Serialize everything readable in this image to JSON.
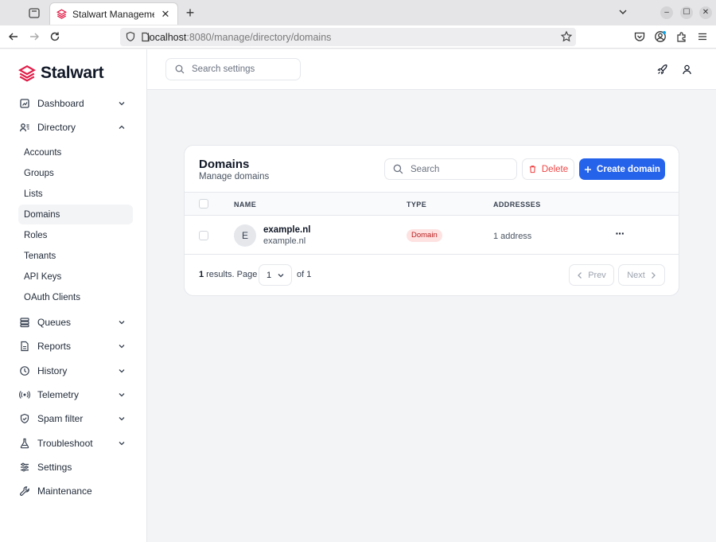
{
  "browser": {
    "tab_title": "Stalwart Management",
    "url_host": "localhost",
    "url_rest": ":8080/manage/directory/domains"
  },
  "brand": {
    "name": "Stalwart",
    "color": "#e11d48"
  },
  "search_settings": {
    "placeholder": "Search settings"
  },
  "sidebar": {
    "items": [
      {
        "label": "Dashboard",
        "icon": "dashboard-icon",
        "expanded": false
      },
      {
        "label": "Directory",
        "icon": "directory-icon",
        "expanded": true
      },
      {
        "label": "Queues",
        "icon": "queues-icon",
        "expanded": false
      },
      {
        "label": "Reports",
        "icon": "reports-icon",
        "expanded": false
      },
      {
        "label": "History",
        "icon": "history-icon",
        "expanded": false
      },
      {
        "label": "Telemetry",
        "icon": "telemetry-icon",
        "expanded": false
      },
      {
        "label": "Spam filter",
        "icon": "shield-icon",
        "expanded": false
      },
      {
        "label": "Troubleshoot",
        "icon": "flask-icon",
        "expanded": false
      },
      {
        "label": "Settings",
        "icon": "sliders-icon"
      },
      {
        "label": "Maintenance",
        "icon": "wrench-icon"
      }
    ],
    "directory_sub": [
      "Accounts",
      "Groups",
      "Lists",
      "Domains",
      "Roles",
      "Tenants",
      "API Keys",
      "OAuth Clients"
    ],
    "active_sub": "Domains"
  },
  "card": {
    "title": "Domains",
    "subtitle": "Manage domains",
    "search_placeholder": "Search",
    "delete_label": "Delete",
    "create_label": "Create domain",
    "columns": [
      "NAME",
      "TYPE",
      "ADDRESSES"
    ],
    "rows": [
      {
        "initial": "E",
        "name": "example.nl",
        "description": "example.nl",
        "type": "Domain",
        "addresses": "1 address"
      }
    ],
    "footer": {
      "count": "1",
      "results_text": "results. Page",
      "page": "1",
      "of_text": "of 1",
      "prev_label": "Prev",
      "next_label": "Next"
    }
  },
  "colors": {
    "primary": "#2563eb",
    "danger": "#ef4444",
    "badge_bg": "#fee2e2",
    "badge_text": "#b91c1c"
  }
}
